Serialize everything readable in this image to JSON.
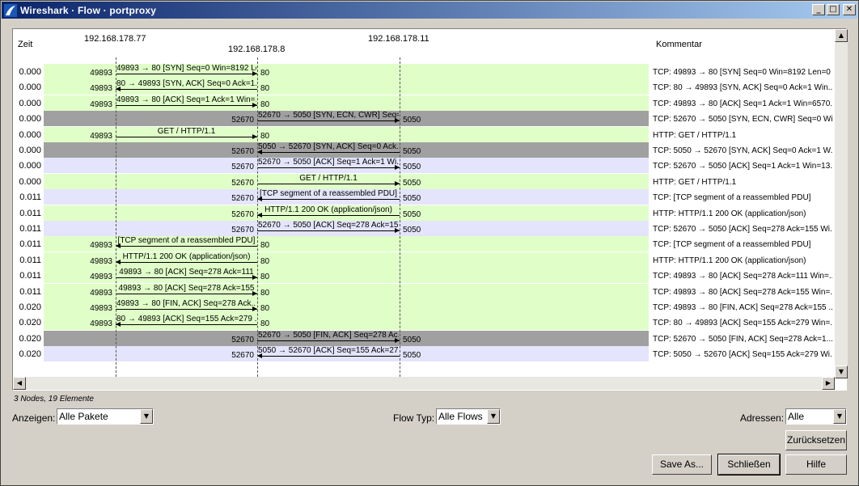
{
  "window": {
    "title": "Wireshark · Flow · portproxy"
  },
  "headers": {
    "time": "Zeit",
    "node1": "192.168.178.77",
    "node2": "192.168.178.8",
    "node3": "192.168.178.11",
    "comment": "Kommentar"
  },
  "colors": {
    "green": "#e0ffc8",
    "gray": "#a0a0a0",
    "lavender": "#e4e4fc"
  },
  "rows": [
    {
      "time": "0.000",
      "color": "green",
      "from": 1,
      "to": 2,
      "label": "49893 → 80 [SYN] Seq=0 Win=8192 Le...",
      "lport": "49893",
      "rport": "80",
      "comment": "TCP: 49893 → 80 [SYN] Seq=0 Win=8192 Len=0 ..."
    },
    {
      "time": "0.000",
      "color": "green",
      "from": 2,
      "to": 1,
      "label": "80 → 49893 [SYN, ACK] Seq=0 Ack=1...",
      "lport": "49893",
      "rport": "80",
      "comment": "TCP: 80 → 49893 [SYN, ACK] Seq=0 Ack=1 Win..."
    },
    {
      "time": "0.000",
      "color": "green",
      "from": 1,
      "to": 2,
      "label": "49893 → 80 [ACK] Seq=1 Ack=1 Win=...",
      "lport": "49893",
      "rport": "80",
      "comment": "TCP: 49893 → 80 [ACK] Seq=1 Ack=1 Win=6570..."
    },
    {
      "time": "0.000",
      "color": "gray",
      "from": 2,
      "to": 3,
      "label": "52670 → 5050 [SYN, ECN, CWR] Seq=...",
      "lport": "52670",
      "rport": "5050",
      "comment": "TCP: 52670 → 5050 [SYN, ECN, CWR] Seq=0 Wi..."
    },
    {
      "time": "0.000",
      "color": "green",
      "from": 1,
      "to": 2,
      "label": "GET / HTTP/1.1",
      "lport": "49893",
      "rport": "80",
      "comment": "HTTP: GET / HTTP/1.1"
    },
    {
      "time": "0.000",
      "color": "gray",
      "from": 3,
      "to": 2,
      "label": "5050 → 52670 [SYN, ACK] Seq=0 Ack...",
      "lport": "52670",
      "rport": "5050",
      "comment": "TCP: 5050 → 52670 [SYN, ACK] Seq=0 Ack=1 W..."
    },
    {
      "time": "0.000",
      "color": "lavender",
      "from": 2,
      "to": 3,
      "label": "52670 → 5050 [ACK] Seq=1 Ack=1 Wi...",
      "lport": "52670",
      "rport": "5050",
      "comment": "TCP: 52670 → 5050 [ACK] Seq=1 Ack=1 Win=13..."
    },
    {
      "time": "0.000",
      "color": "green",
      "from": 2,
      "to": 3,
      "label": "GET / HTTP/1.1",
      "lport": "52670",
      "rport": "5050",
      "comment": "HTTP: GET / HTTP/1.1"
    },
    {
      "time": "0.011",
      "color": "lavender",
      "from": 3,
      "to": 2,
      "label": "[TCP segment of a reassembled PDU]",
      "lport": "52670",
      "rport": "5050",
      "comment": "TCP: [TCP segment of a reassembled PDU]"
    },
    {
      "time": "0.011",
      "color": "green",
      "from": 3,
      "to": 2,
      "label": "HTTP/1.1 200 OK  (application/json)",
      "lport": "52670",
      "rport": "5050",
      "comment": "HTTP: HTTP/1.1 200 OK  (application/json)"
    },
    {
      "time": "0.011",
      "color": "lavender",
      "from": 2,
      "to": 3,
      "label": "52670 → 5050 [ACK] Seq=278 Ack=15...",
      "lport": "52670",
      "rport": "5050",
      "comment": "TCP: 52670 → 5050 [ACK] Seq=278 Ack=155 Wi..."
    },
    {
      "time": "0.011",
      "color": "green",
      "from": 2,
      "to": 1,
      "label": "[TCP segment of a reassembled PDU]",
      "lport": "49893",
      "rport": "80",
      "comment": "TCP: [TCP segment of a reassembled PDU]"
    },
    {
      "time": "0.011",
      "color": "green",
      "from": 2,
      "to": 1,
      "label": "HTTP/1.1 200 OK  (application/json)",
      "lport": "49893",
      "rport": "80",
      "comment": "HTTP: HTTP/1.1 200 OK  (application/json)"
    },
    {
      "time": "0.011",
      "color": "green",
      "from": 1,
      "to": 2,
      "label": "49893 → 80 [ACK] Seq=278 Ack=111",
      "lport": "49893",
      "rport": "80",
      "comment": "TCP: 49893 → 80 [ACK] Seq=278 Ack=111 Win=..."
    },
    {
      "time": "0.011",
      "color": "green",
      "from": 1,
      "to": 2,
      "label": "49893 → 80 [ACK] Seq=278 Ack=155",
      "lport": "49893",
      "rport": "80",
      "comment": "TCP: 49893 → 80 [ACK] Seq=278 Ack=155 Win=..."
    },
    {
      "time": "0.020",
      "color": "green",
      "from": 1,
      "to": 2,
      "label": "49893 → 80 [FIN, ACK] Seq=278 Ack...",
      "lport": "49893",
      "rport": "80",
      "comment": "TCP: 49893 → 80 [FIN, ACK] Seq=278 Ack=155 ..."
    },
    {
      "time": "0.020",
      "color": "green",
      "from": 2,
      "to": 1,
      "label": "80 → 49893 [ACK] Seq=155 Ack=279 ...",
      "lport": "49893",
      "rport": "80",
      "comment": "TCP: 80 → 49893 [ACK] Seq=155 Ack=279 Win=..."
    },
    {
      "time": "0.020",
      "color": "gray",
      "from": 2,
      "to": 3,
      "label": "52670 → 5050 [FIN, ACK] Seq=278 Ac...",
      "lport": "52670",
      "rport": "5050",
      "comment": "TCP: 52670 → 5050 [FIN, ACK] Seq=278 Ack=1..."
    },
    {
      "time": "0.020",
      "color": "lavender",
      "from": 3,
      "to": 2,
      "label": "5050 → 52670 [ACK] Seq=155 Ack=27...",
      "lport": "52670",
      "rport": "5050",
      "comment": "TCP: 5050 → 52670 [ACK] Seq=155 Ack=279 Wi..."
    }
  ],
  "status": "3 Nodes, 19 Elemente",
  "controls": {
    "show_label": "Anzeigen:",
    "show_value": "Alle Pakete",
    "flowtype_label": "Flow Typ:",
    "flowtype_value": "Alle Flows",
    "addr_label": "Adressen:",
    "addr_value": "Alle",
    "reset": "Zurücksetzen",
    "save_as": "Save As...",
    "close": "Schließen",
    "help": "Hilfe"
  }
}
